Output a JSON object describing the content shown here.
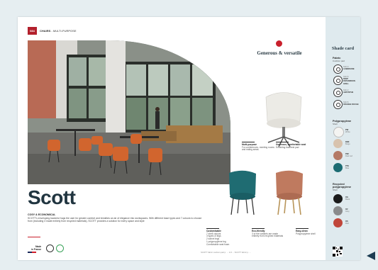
{
  "header": {
    "page_number": "084",
    "category_bold": "CHAIRS",
    "category_rest": " - MULTI-PURPOSE",
    "product": "SCOTT",
    "page_number_right": "085"
  },
  "title": {
    "main": "Scott",
    "tagline": "COSY & ECONOMICAL",
    "body": "SCOTT's enveloping backrest hugs the user for greater comfort and breathes an air of elegance into workspaces. With different base types and 7 colours to choose from (including 3 made entirely from recycled materials), SCOTT provides a solution for every space and style"
  },
  "made_in": {
    "line1": "Made",
    "line2": "in France"
  },
  "features_title": "Generous & versatile",
  "features": [
    {
      "title": "Multi-purpose",
      "text": "For conferences, meeting rooms and eating areas"
    },
    {
      "title": "Generous, comfortable seat",
      "text": "Enfolding backrest pad"
    },
    {
      "title": "Customisable",
      "text": "7 shell colours\n3 types of legs\n2 swivel legs\n1 polypropylene leg\nComfortable seat foam"
    },
    {
      "title": "Eco-friendly",
      "text": "3 of the variants are made entirely from recycled materials"
    },
    {
      "title": "Easy-clean",
      "text": "Polypropylene shell"
    }
  ],
  "shade_card": {
    "title": "Shade card",
    "fabric": {
      "title": "Fabric",
      "subtitle": "Cushion pad",
      "items": [
        {
          "code": "SAN 3",
          "name": "AUBERGINE"
        },
        {
          "code": "SAN 5",
          "name": "DEEP PAPERMOON GRILL"
        },
        {
          "code": "SAN 2",
          "name": "ABSYNTHE"
        },
        {
          "code": "SAN 6",
          "name": "ORANGE ROUGE"
        }
      ]
    },
    "polypropylene": {
      "title": "Polypropylene",
      "subtitle": "Shell",
      "items": [
        {
          "code": "PW",
          "name": "White",
          "color": "#f4f4f2"
        },
        {
          "code": "BBE",
          "name": "Beige",
          "color": "#d8c3ae"
        },
        {
          "code": "PIM",
          "name": "Dark red",
          "color": "#b47a66"
        },
        {
          "code": "PTE",
          "name": "Blue",
          "color": "#1b6b72"
        }
      ]
    },
    "recycled": {
      "title": "Recycled polypropylene",
      "subtitle": "Shell",
      "items": [
        {
          "code": "OG",
          "name": "Black",
          "color": "#1a1a1a"
        },
        {
          "code": "OZ",
          "name": "Grey",
          "color": "#8a8b8c"
        },
        {
          "code": "OS",
          "name": "Red",
          "color": "#c0463a"
        }
      ]
    }
  },
  "footnote": "SCOTT fabric cushion pad p. ... 1/4 ... SCOTT fabric p. ..."
}
